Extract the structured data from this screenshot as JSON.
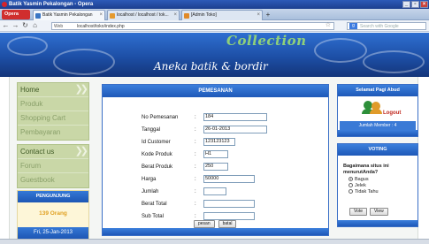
{
  "browser": {
    "window_title": "Batik Yasmin Pekalongan - Opera",
    "menu_label": "Opera",
    "tabs": [
      {
        "label": "Batik Yasmin Pekalongan",
        "active": true
      },
      {
        "label": "localhost / localhost / tok...",
        "active": false
      },
      {
        "label": "[Admin Toko]",
        "active": false
      }
    ],
    "web_label": "Web",
    "url": "localhost/toko/index.php",
    "search_placeholder": "Search with Google",
    "search_engine_icon": "google-icon"
  },
  "banner": {
    "collection_text": "Collection",
    "subtitle": "Aneka batik & bordir"
  },
  "leftnav": {
    "group1": [
      "Home",
      "Produk",
      "Shopping Cart",
      "Pembayaran"
    ],
    "group2": [
      "Contact us",
      "Forum",
      "Guestbook"
    ]
  },
  "counter": {
    "title": "PENGUNJUNG",
    "value": "139 Orang",
    "date": "Fri, 25-Jan-2013"
  },
  "order": {
    "title": "PEMESANAN",
    "fields": [
      {
        "label": "No Pemesanan",
        "value": "184"
      },
      {
        "label": "Tanggal",
        "value": "26-01-2013"
      },
      {
        "label": "Id Customer",
        "value": "123123123"
      },
      {
        "label": "Kode Produk",
        "value": "H1"
      },
      {
        "label": "Berat Produk",
        "value": "250"
      },
      {
        "label": "Harga",
        "value": "50000"
      },
      {
        "label": "Jumlah",
        "value": ""
      },
      {
        "label": "Berat Total",
        "value": ""
      },
      {
        "label": "Sub Total",
        "value": ""
      }
    ],
    "colon": ":",
    "buttons": {
      "submit": "pesan",
      "cancel": "batal"
    }
  },
  "greeting": {
    "title": "Selamat Pagi Abud",
    "logout": "Logout",
    "member": "Jumlah Member : 4"
  },
  "poll": {
    "title": "VOTING",
    "question": "Bagaimana situs ini menurutAnda?",
    "options": [
      "Bagus",
      "Jelek",
      "Tidak Tahu"
    ],
    "selected": "Bagus",
    "buttons": {
      "vote": "Vote",
      "view": "View"
    }
  },
  "colors": {
    "accent_blue": "#1e58b8",
    "nav_green": "#c9d7a7",
    "counter_orange": "#e0a021",
    "logout_red": "#c0281e"
  }
}
